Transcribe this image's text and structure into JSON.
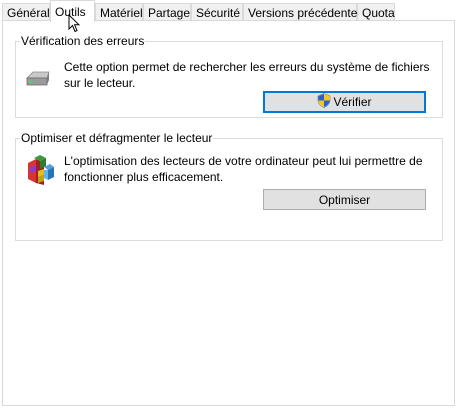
{
  "tabs": [
    {
      "label": "Général"
    },
    {
      "label": "Outils"
    },
    {
      "label": "Matériel"
    },
    {
      "label": "Partage"
    },
    {
      "label": "Sécurité"
    },
    {
      "label": "Versions précédentes"
    },
    {
      "label": "Quota"
    }
  ],
  "active_tab": "Outils",
  "error_check": {
    "title": "Vérification des erreurs",
    "description": "Cette option permet de rechercher les erreurs du système de fichiers sur le lecteur.",
    "button_label": "Vérifier",
    "icon": "drive-icon",
    "button_icon": "uac-shield-icon"
  },
  "optimize": {
    "title": "Optimiser et défragmenter le lecteur",
    "description": "L'optimisation des lecteurs de votre ordinateur peut lui permettre de fonctionner plus efficacement.",
    "button_label": "Optimiser",
    "icon": "defrag-icon"
  },
  "colors": {
    "focus_border": "#0078d7",
    "button_bg": "#e1e1e1",
    "group_border": "#dcdcdc"
  }
}
